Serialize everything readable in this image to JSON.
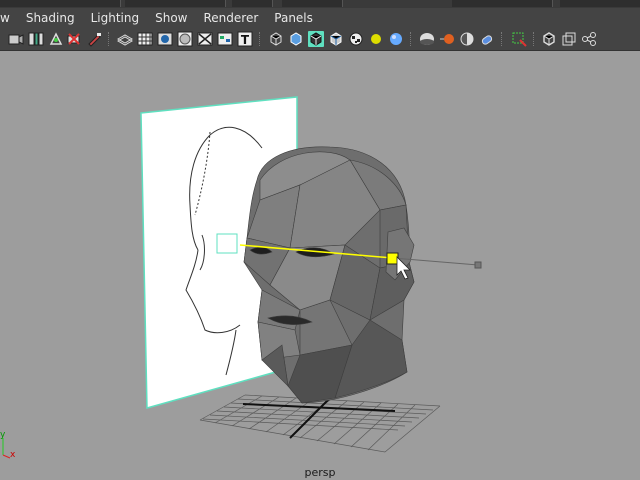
{
  "menubar": {
    "items": [
      "w",
      "Shading",
      "Lighting",
      "Show",
      "Renderer",
      "Panels"
    ]
  },
  "toolbar": {
    "icons": [
      "select-camera-icon",
      "camera-attributes-icon",
      "bookmark-icon",
      "image-plane-icon",
      "2d-pan-zoom-icon",
      "grease-pencil-icon",
      "wireframe-icon",
      "grid-icon",
      "film-gate-icon",
      "resolution-gate-icon",
      "gate-mask-icon",
      "field-chart-icon",
      "safe-action-icon",
      "safe-title-icon",
      "wireframe-shading-icon",
      "smooth-shading-icon",
      "wireframe-on-shaded-icon",
      "default-material-icon",
      "textured-icon",
      "use-all-lights-icon",
      "shadows-icon",
      "screen-space-ao-icon",
      "motion-blur-icon",
      "multisample-aa-icon",
      "depth-of-field-icon",
      "isolate-select-icon",
      "xray-icon",
      "xray-active-components-icon",
      "xray-joints-icon",
      "node-editor-icon"
    ]
  },
  "viewport": {
    "camera_name": "persp",
    "axis": {
      "x": "x",
      "y": "y"
    }
  },
  "colors": {
    "ui_bg": "#444444",
    "viewport_bg": "#9d9d9d",
    "selection_highlight": "#5fe0c0",
    "active_curve": "#ffff00"
  }
}
